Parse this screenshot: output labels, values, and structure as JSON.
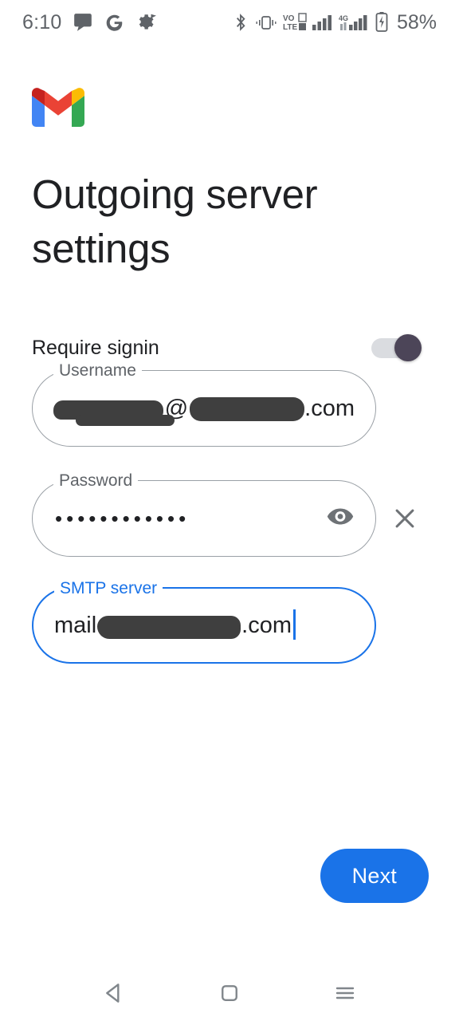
{
  "status_bar": {
    "time": "6:10",
    "battery_percent": "58%",
    "left_icons": [
      "message-bubble-icon",
      "google-g-icon",
      "settings-gear-icon"
    ],
    "right_icons": [
      "bluetooth-icon",
      "vibrate-icon",
      "volte-icon",
      "signal-bars-icon",
      "signal-4g-icon",
      "battery-charging-icon"
    ]
  },
  "app": {
    "logo": "gmail-logo",
    "title": "Outgoing server settings"
  },
  "settings": {
    "require_signin_label": "Require signin",
    "require_signin_state": "on"
  },
  "fields": {
    "username": {
      "label": "Username",
      "value_prefix": "",
      "value_at": "@",
      "value_suffix": ".com",
      "redacted": true
    },
    "password": {
      "label": "Password",
      "value": "••••••••••••",
      "reveal_icon": "eye-icon",
      "clear_icon": "close-icon"
    },
    "smtp_server": {
      "label": "SMTP server",
      "value_prefix": "mail",
      "value_suffix": ".com",
      "focused": true,
      "redacted": true
    }
  },
  "actions": {
    "next_label": "Next"
  },
  "nav_bar": {
    "back": "back-icon",
    "home": "home-icon",
    "recents": "recents-icon"
  },
  "colors": {
    "accent": "#1a73e8",
    "toggle_thumb": "#4c4558",
    "text_primary": "#202124",
    "text_secondary": "#5f6368",
    "field_border": "#9aa0a6"
  }
}
